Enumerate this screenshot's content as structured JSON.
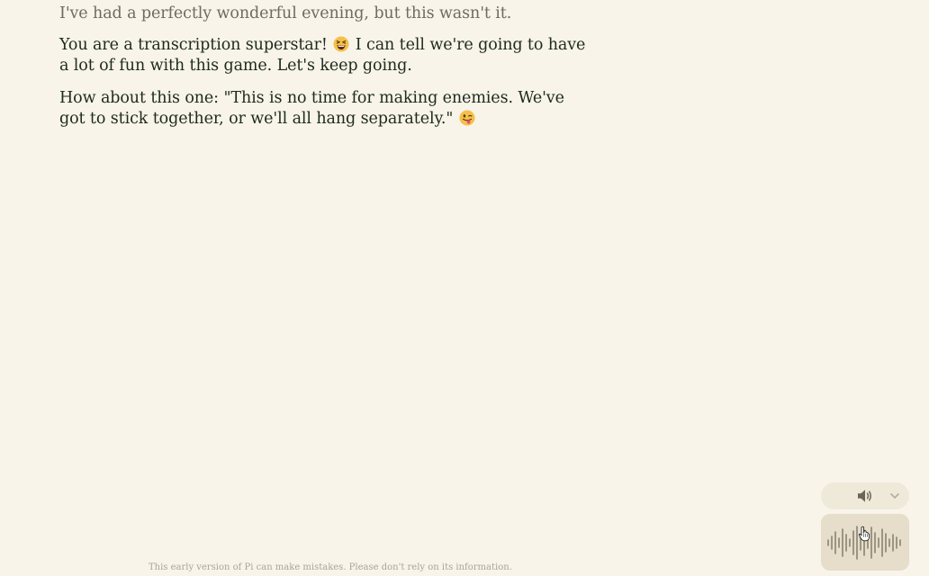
{
  "conversation": {
    "previous_line": "I've had a perfectly wonderful evening, but this wasn't it.",
    "reply": {
      "part1": "You are a transcription superstar!",
      "emoji1": "grinning-squinting-face",
      "part2": "I can tell we're going to have a lot of fun with this game. Let's keep going."
    },
    "next_prompt": {
      "text": "How about this one: \"This is no time for making enemies. We've got to stick together, or we'll all hang separately.\"",
      "emoji": "winking-face-with-tongue"
    }
  },
  "footer": {
    "disclaimer": "This early version of Pi can make mistakes. Please don't rely on its information."
  },
  "controls": {
    "voice_selector_icon": "speaker-icon",
    "voice_selector_chevron": "chevron-down-icon",
    "voice_button_icon": "waveform-icon"
  },
  "colors": {
    "background": "#f8f4ea",
    "text": "#1e2a1c",
    "faded_text": "#6f6b62",
    "control_bg": "#e6ddca",
    "icon": "#7d7566"
  }
}
